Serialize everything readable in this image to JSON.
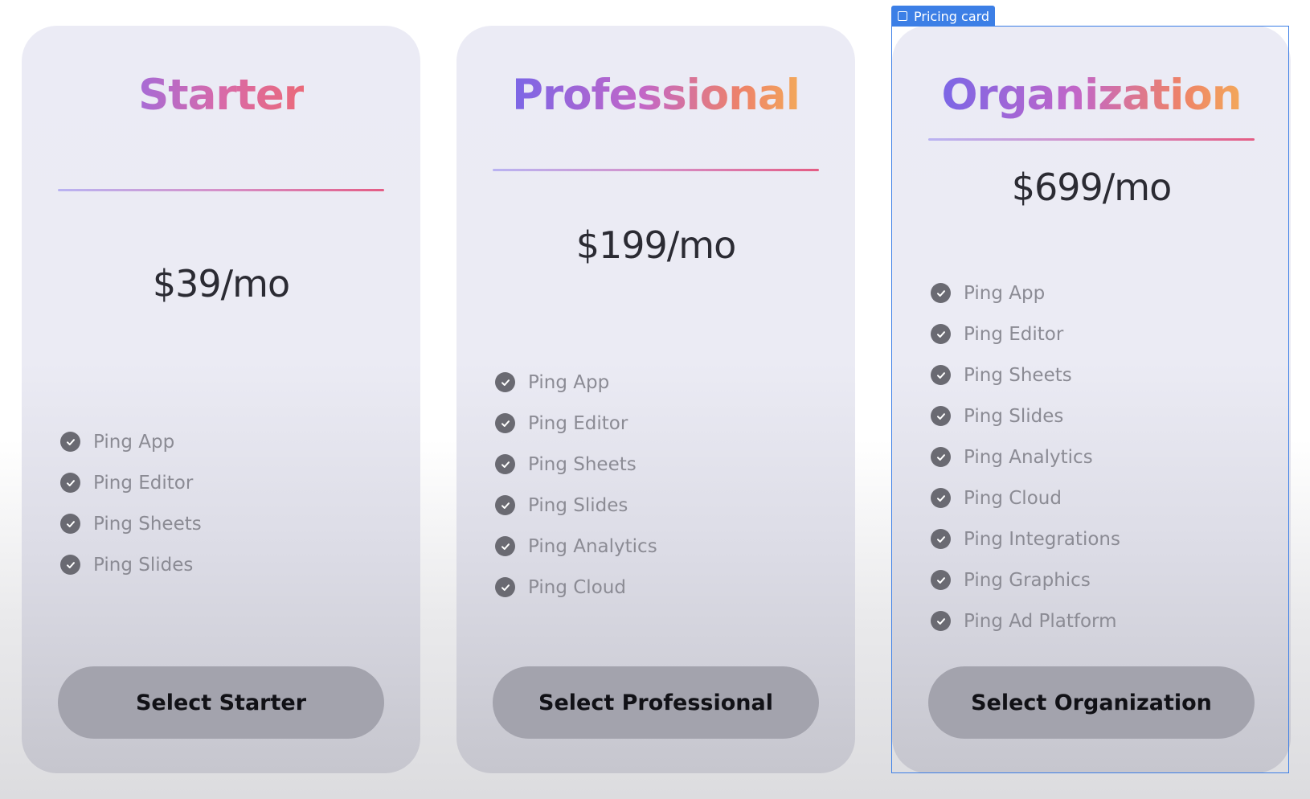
{
  "selection": {
    "label": "Pricing card",
    "icon": "frame-icon",
    "color": "#3c7fe6"
  },
  "plans": [
    {
      "name": "Starter",
      "price": "$39/mo",
      "features": [
        "Ping App",
        "Ping Editor",
        "Ping Sheets",
        "Ping Slides"
      ],
      "cta": "Select Starter"
    },
    {
      "name": "Professional",
      "price": "$199/mo",
      "features": [
        "Ping App",
        "Ping Editor",
        "Ping Sheets",
        "Ping Slides",
        "Ping Analytics",
        "Ping Cloud"
      ],
      "cta": "Select Professional"
    },
    {
      "name": "Organization",
      "price": "$699/mo",
      "features": [
        "Ping App",
        "Ping Editor",
        "Ping Sheets",
        "Ping Slides",
        "Ping Analytics",
        "Ping Cloud",
        "Ping Integrations",
        "Ping Graphics",
        "Ping Ad Platform"
      ],
      "cta": "Select Organization"
    }
  ],
  "icons": {
    "feature_check": "check-circle-icon"
  },
  "colors": {
    "card_bg": "#ebebf5",
    "button_bg": "#a3a3ad",
    "price_text": "#2b2b33",
    "feature_text": "#8b8b94",
    "check_bg": "#6a6a72"
  }
}
